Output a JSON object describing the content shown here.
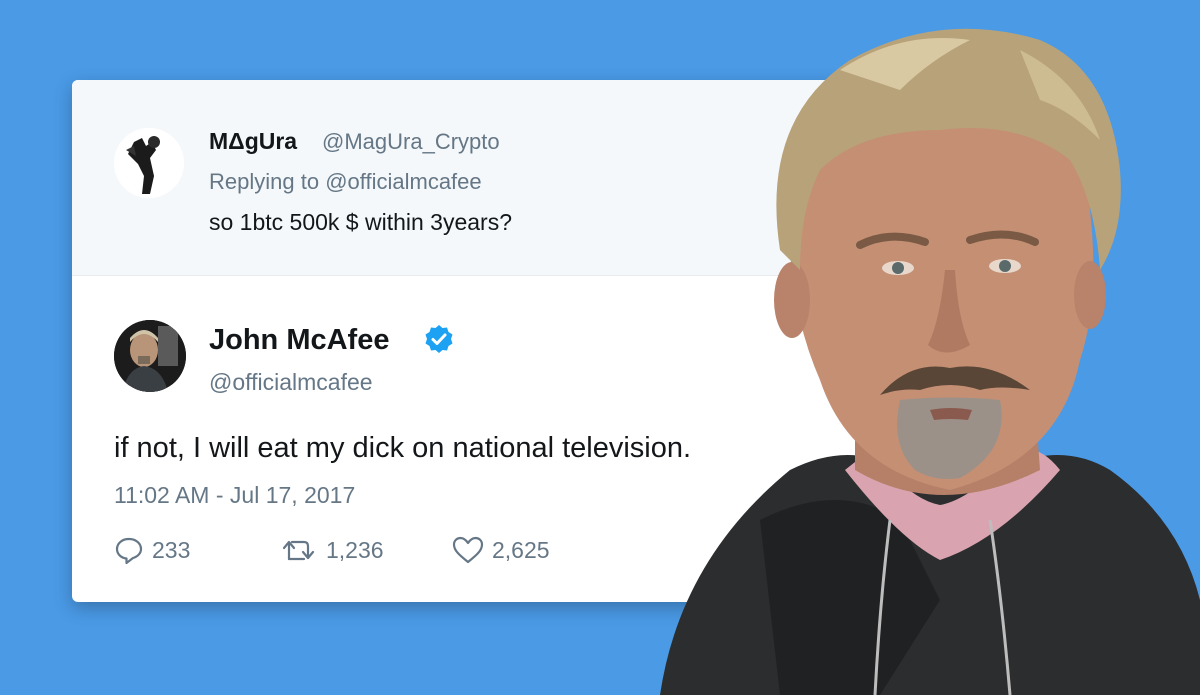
{
  "reply_tweet": {
    "display_name": "MΔgUra",
    "handle": "@MagUra_Crypto",
    "replying_prefix": "Replying to",
    "replying_mention": "@officialmcafee",
    "text": "so 1btc 500k $ within 3years?"
  },
  "main_tweet": {
    "display_name": "John McAfee",
    "handle": "@officialmcafee",
    "text": "if not, I will eat my dick on national television.",
    "timestamp": "11:02 AM - Jul 17, 2017",
    "replies": "233",
    "retweets": "1,236",
    "likes": "2,625"
  },
  "colors": {
    "background": "#4a9ae6",
    "verified": "#1da1f2",
    "muted_text": "#657786"
  },
  "icons": [
    "reply-icon",
    "retweet-icon",
    "like-icon",
    "verified-badge-icon"
  ]
}
